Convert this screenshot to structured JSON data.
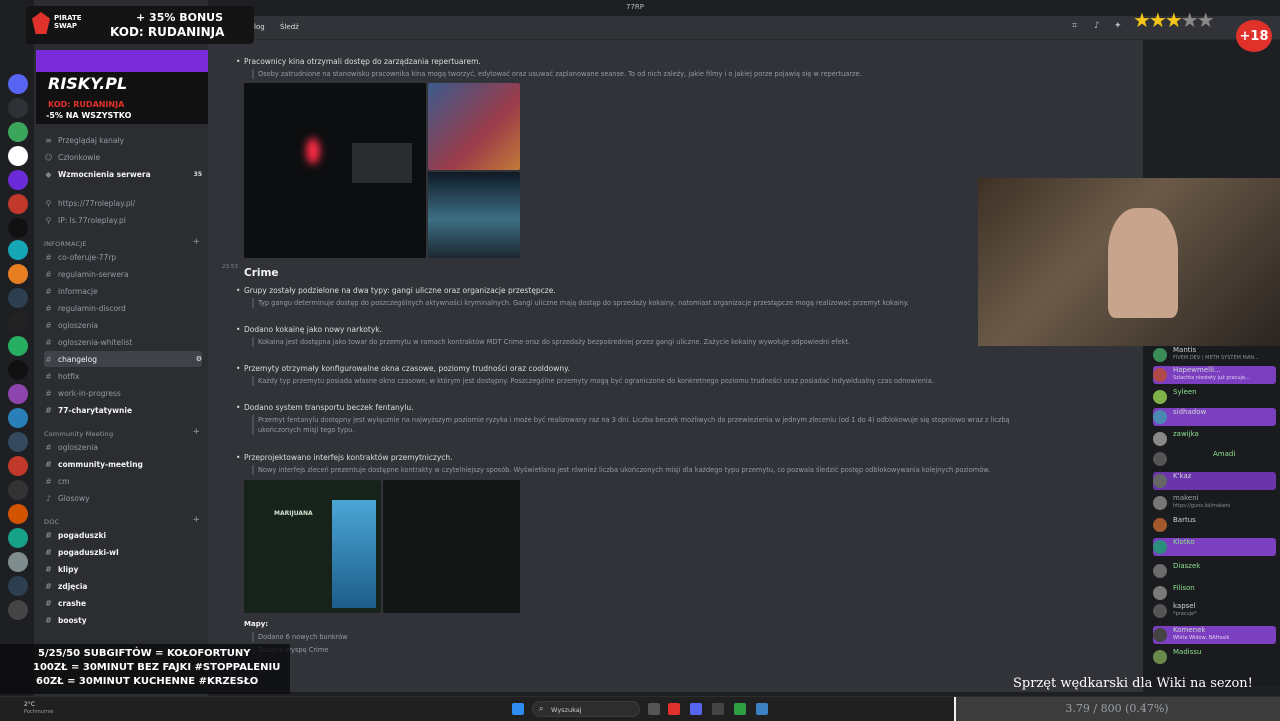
{
  "window": {
    "title": "77RP"
  },
  "header": {
    "tab_log": "log",
    "tab_follow": "Śledź"
  },
  "overlays": {
    "promo_brand": "PIRATE SWAP",
    "promo_bonus": "+ 35% BONUS",
    "promo_code": "KOD: RUDANINJA",
    "risky_brand": "RISKY.PL",
    "risky_code": "KOD: RUDANINJA",
    "risky_discount": "-5% NA WSZYSTKO",
    "age_badge": "+18",
    "goals_line1": "5/25/50 SUBGIFTÓW = KOŁOFORTUNY",
    "goals_line2": "100ZŁ = 30MINUT BEZ FAJKI #STOPPALENIU",
    "goals_line3": "60ZŁ = 30MINUT KUCHENNE #KRZESŁO",
    "ticker_text": "Sprzęt wędkarski dla Wiki na sezon!",
    "progress_text": "3.79 / 800 (0.47%)",
    "progress_fraction": 0.0047
  },
  "sidebar": {
    "top_items": [
      {
        "label": "Przeglądaj kanały"
      },
      {
        "label": "Członkowie"
      },
      {
        "label": "Wzmocnienia serwera",
        "count": "35"
      },
      {
        "label": "https://77roleplay.pl/"
      },
      {
        "label": "IP: ls.77roleplay.pl"
      }
    ],
    "cat_info": "INFORMACJE",
    "info_channels": [
      "co-oferuje-77rp",
      "regulamin-serwera",
      "informacje",
      "regulamin-discord",
      "ogloszenia",
      "ogloszenia-whitelist",
      "changelog",
      "hotfix",
      "work-in-progress",
      "77-charytatywnie"
    ],
    "cat_meeting": "Community Meeting",
    "meeting_channels": [
      "ogloszenia",
      "community-meeting",
      "cm",
      "Glosowy"
    ],
    "cat_doc": "DOC",
    "doc_channels": [
      "pogaduszki",
      "pogaduszki-wl",
      "klipy",
      "zdjęcia",
      "crashe",
      "boosty"
    ]
  },
  "main": {
    "bullet_cinema": "Pracownicy kina otrzymali dostęp do zarządzania repertuarem.",
    "quote_cinema": "Osoby zatrudnione na stanowisku pracownika kina mogą tworzyć, edytować oraz usuwać zaplanowane seanse. To od nich zależy, jakie filmy i o jakiej porze pojawią się w repertuarze.",
    "timestamp": "23:53",
    "section_title": "Crime",
    "items": [
      {
        "title": "Grupy zostały podzielone na dwa typy: gangi uliczne oraz organizacje przestępcze.",
        "desc": "Typ gangu determinuje dostęp do poszczególnych aktywności kryminalnych. Gangi uliczne mają dostęp do sprzedaży kokainy, natomiast organizacje przestępcze mogą realizować przemyt kokainy."
      },
      {
        "title": "Dodano kokainę jako nowy narkotyk.",
        "desc": "Kokaina jest dostępna jako towar do przemytu w ramach kontraktów MDT Crime oraz do sprzedaży bezpośredniej przez gangi uliczne. Zażycie kokainy wywołuje odpowiedni efekt."
      },
      {
        "title": "Przemyty otrzymały konfigurowalne okna czasowe, poziomy trudności oraz cooldowny.",
        "desc": "Każdy typ przemytu posiada własne okno czasowe, w którym jest dostępny. Poszczególne przemyty mogą być ograniczone do konkretnego poziomu trudności oraz posiadać indywidualny czas odnowienia."
      },
      {
        "title": "Dodano system transportu beczek fentanylu.",
        "desc": "Przemyt fentanylu dostępny jest wyłącznie na najwyższym poziomie ryzyka i może być realizowany raz na 3 dni. Liczba beczek możliwych do przewiezienia w jednym zleceniu (od 1 do 4) odblokowuje się stopniowo wraz z liczbą ukończonych misji tego typu."
      },
      {
        "title": "Przeprojektowano interfejs kontraktów przemytniczych.",
        "desc": "Nowy interfejs zleceń prezentuje dostępne kontrakty w czytelniejszy sposób. Wyświetlana jest również liczba ukończonych misji dla każdego typu przemytu, co pozwala śledzić postęp odblokowywania kolejnych poziomów."
      }
    ],
    "img_label": "MARIJUANA",
    "maps_title": "Mapy:",
    "maps_items": [
      "Dodano 6 nowych bunkrów",
      "Dodano wyspę Crime"
    ]
  },
  "chat": {
    "messages": [
      {
        "name": "Mantis",
        "badge": "CODE",
        "sub": "FIVEM DEV | METH SYSTEM MAN..."
      },
      {
        "name": "Hapewmelli...",
        "badge": "77RP",
        "sub": "Szlachta niestety już pracuje..."
      },
      {
        "name": "Syleen",
        "badge": "",
        "sub": ""
      },
      {
        "name": "sidhadow",
        "badge": "CACK",
        "sub": ""
      },
      {
        "name": "zawijka",
        "badge": "77RP",
        "sub": ""
      },
      {
        "name": "Amadi",
        "badge": "",
        "sub": ""
      },
      {
        "name": "K'kaz",
        "badge": "",
        "sub": ""
      },
      {
        "name": "makeni",
        "badge": "",
        "sub": "https://guns.lol/makeni"
      },
      {
        "name": "Bartus",
        "badge": "GIT",
        "sub": ""
      },
      {
        "name": "Klotko",
        "badge": "",
        "sub": ""
      },
      {
        "name": "Diaszek",
        "badge": "",
        "sub": ""
      },
      {
        "name": "Filison",
        "badge": "",
        "sub": ""
      },
      {
        "name": "kapsel",
        "badge": "",
        "sub": "*pracuje*"
      },
      {
        "name": "Komenek",
        "badge": "HESI",
        "sub": "White Widow, BAHosik"
      },
      {
        "name": "Madissu",
        "badge": "",
        "sub": ""
      }
    ]
  },
  "taskbar": {
    "search_placeholder": "Wyszukaj",
    "weather": "2°C",
    "weather_sub": "Pochmurnie"
  },
  "colors": {
    "discord_bg": "#313338",
    "sidebar_bg": "#2b2d31",
    "accent_red": "#e0312a",
    "chat_purple": "#7b3fbf"
  }
}
